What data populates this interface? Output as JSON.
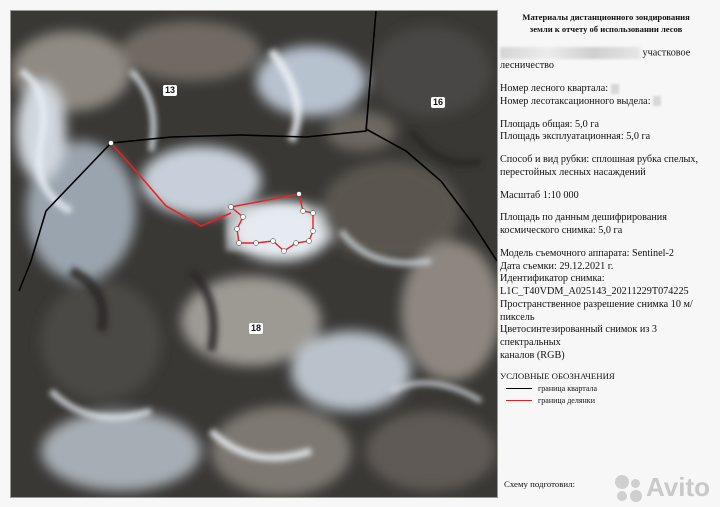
{
  "header": {
    "title_line1": "Материалы дистанционного зондирования",
    "title_line2": "земли к отчету об использовании лесов"
  },
  "info": {
    "forestry_suffix": "участковое",
    "forestry_word": "лесничество",
    "quarter_label": "Номер лесного квартала:",
    "allotment_label": "Номер лесотаксационного выдела:",
    "area_total": "Площадь общая: 5,0 га",
    "area_operational": "Площадь эксплуатационная: 5,0 га",
    "cutting_line1": "Способ и вид рубки: сплошная рубка спелых,",
    "cutting_line2": "перестойных лесных насаждений",
    "scale": "Масштаб 1:10 000",
    "decoded_line1": "Площадь по данным дешифрирования",
    "decoded_line2": "космического снимка: 5,0 га",
    "camera": "Модель съемочного аппарата: Sentinel-2",
    "date": "Дата съемки: 29.12.2021 г.",
    "id_label": "Идентификатор снимка:",
    "id_value": "L1C_T40VDM_A025143_20211229T074225",
    "resolution_line1": "Пространственное разрешение снимка 10 м/",
    "resolution_line2": "пиксель",
    "synth_line1": "Цветосинтезированный снимок из 3",
    "synth_line2": "спектральных",
    "synth_line3": "каналов (RGB)"
  },
  "legend": {
    "title": "УСЛОВНЫЕ ОБОЗНАЧЕНИЯ",
    "quarter_boundary": "граница квартала",
    "plot_boundary": "граница делянки",
    "quarter_color": "#000000",
    "plot_color": "#e02020"
  },
  "footer": {
    "prepared": "Схему подготовил:"
  },
  "map": {
    "quarter_13": "13",
    "quarter_16": "16",
    "quarter_18": "18"
  },
  "watermark": {
    "text": "Avito"
  }
}
